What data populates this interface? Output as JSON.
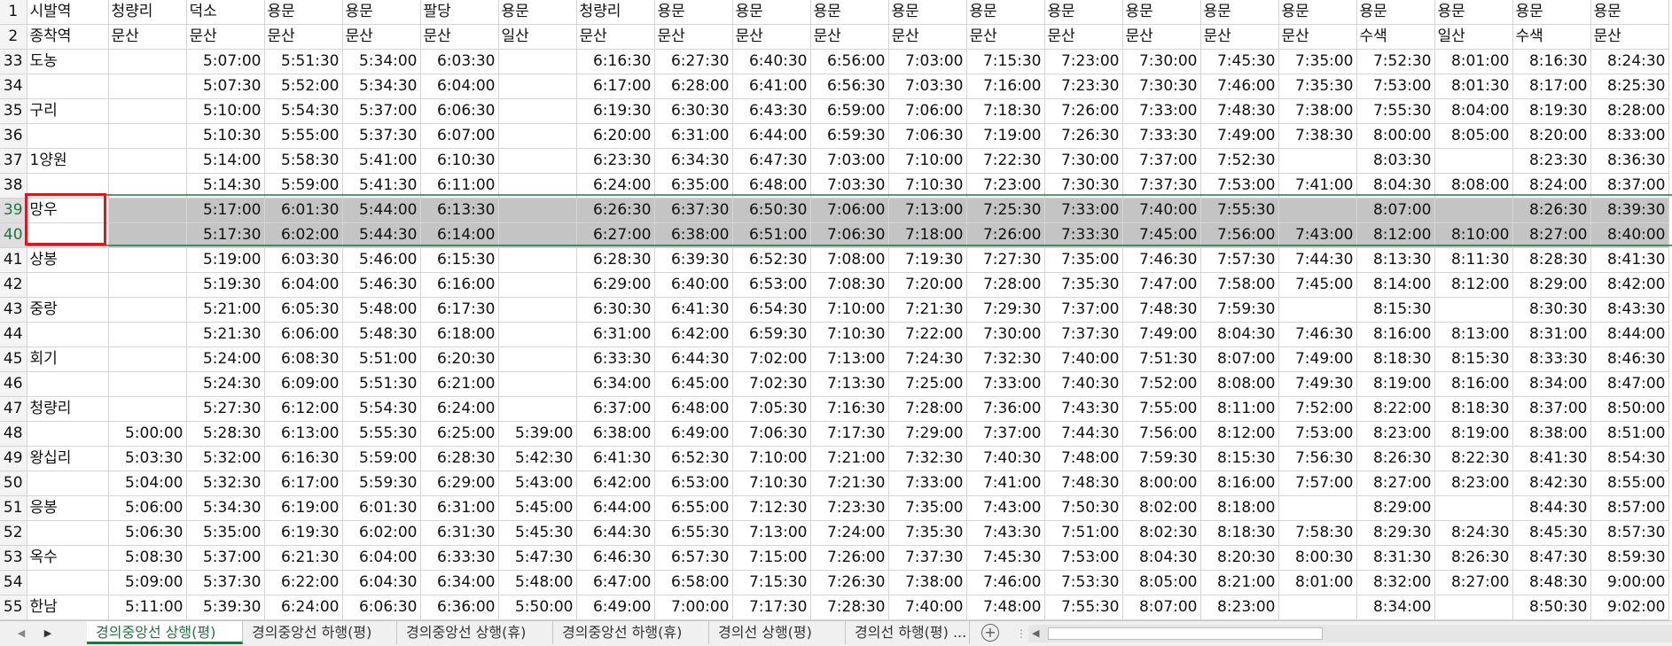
{
  "header_rows": [
    {
      "row": "1",
      "cells": [
        "시발역",
        "청량리",
        "덕소",
        "용문",
        "용문",
        "팔당",
        "용문",
        "청량리",
        "용문",
        "용문",
        "용문",
        "용문",
        "용문",
        "용문",
        "용문",
        "용문",
        "용문",
        "용문",
        "용문",
        "용문",
        "용문",
        "용문"
      ]
    },
    {
      "row": "2",
      "cells": [
        "종착역",
        "문산",
        "문산",
        "문산",
        "문산",
        "문산",
        "일산",
        "문산",
        "문산",
        "문산",
        "문산",
        "문산",
        "문산",
        "문산",
        "문산",
        "문산",
        "문산",
        "수색",
        "일산",
        "수색",
        "문산",
        "문산"
      ]
    }
  ],
  "rows": [
    {
      "row": "33",
      "cells": [
        "도농",
        "",
        "5:07:00",
        "5:51:30",
        "5:34:00",
        "6:03:30",
        "",
        "6:16:30",
        "6:27:30",
        "6:40:30",
        "6:56:00",
        "7:03:00",
        "7:15:30",
        "7:23:00",
        "7:30:00",
        "7:45:30",
        "7:35:00",
        "7:52:30",
        "8:01:00",
        "8:16:30",
        "8:24:30"
      ]
    },
    {
      "row": "34",
      "cells": [
        "",
        "",
        "5:07:30",
        "5:52:00",
        "5:34:30",
        "6:04:00",
        "",
        "6:17:00",
        "6:28:00",
        "6:41:00",
        "6:56:30",
        "7:03:30",
        "7:16:00",
        "7:23:30",
        "7:30:30",
        "7:46:00",
        "7:35:30",
        "7:53:00",
        "8:01:30",
        "8:17:00",
        "8:25:30"
      ]
    },
    {
      "row": "35",
      "cells": [
        "구리",
        "",
        "5:10:00",
        "5:54:30",
        "5:37:00",
        "6:06:30",
        "",
        "6:19:30",
        "6:30:30",
        "6:43:30",
        "6:59:00",
        "7:06:00",
        "7:18:30",
        "7:26:00",
        "7:33:00",
        "7:48:30",
        "7:38:00",
        "7:55:30",
        "8:04:00",
        "8:19:30",
        "8:28:00"
      ]
    },
    {
      "row": "36",
      "cells": [
        "",
        "",
        "5:10:30",
        "5:55:00",
        "5:37:30",
        "6:07:00",
        "",
        "6:20:00",
        "6:31:00",
        "6:44:00",
        "6:59:30",
        "7:06:30",
        "7:19:00",
        "7:26:30",
        "7:33:30",
        "7:49:00",
        "7:38:30",
        "8:00:00",
        "8:05:00",
        "8:20:00",
        "8:33:00"
      ]
    },
    {
      "row": "37",
      "cells": [
        "1양원",
        "",
        "5:14:00",
        "5:58:30",
        "5:41:00",
        "6:10:30",
        "",
        "6:23:30",
        "6:34:30",
        "6:47:30",
        "7:03:00",
        "7:10:00",
        "7:22:30",
        "7:30:00",
        "7:37:00",
        "7:52:30",
        "",
        "8:03:30",
        "",
        "8:23:30",
        "8:36:30"
      ]
    },
    {
      "row": "38",
      "cells": [
        "",
        "",
        "5:14:30",
        "5:59:00",
        "5:41:30",
        "6:11:00",
        "",
        "6:24:00",
        "6:35:00",
        "6:48:00",
        "7:03:30",
        "7:10:30",
        "7:23:00",
        "7:30:30",
        "7:37:30",
        "7:53:00",
        "7:41:00",
        "8:04:30",
        "8:08:00",
        "8:24:00",
        "8:37:00"
      ]
    },
    {
      "row": "39",
      "sel": true,
      "cells": [
        "망우",
        "",
        "5:17:00",
        "6:01:30",
        "5:44:00",
        "6:13:30",
        "",
        "6:26:30",
        "6:37:30",
        "6:50:30",
        "7:06:00",
        "7:13:00",
        "7:25:30",
        "7:33:00",
        "7:40:00",
        "7:55:30",
        "",
        "8:07:00",
        "",
        "8:26:30",
        "8:39:30"
      ]
    },
    {
      "row": "40",
      "sel": true,
      "cells": [
        "",
        "",
        "5:17:30",
        "6:02:00",
        "5:44:30",
        "6:14:00",
        "",
        "6:27:00",
        "6:38:00",
        "6:51:00",
        "7:06:30",
        "7:18:00",
        "7:26:00",
        "7:33:30",
        "7:45:00",
        "7:56:00",
        "7:43:00",
        "8:12:00",
        "8:10:00",
        "8:27:00",
        "8:40:00"
      ]
    },
    {
      "row": "41",
      "cells": [
        "상봉",
        "",
        "5:19:00",
        "6:03:30",
        "5:46:00",
        "6:15:30",
        "",
        "6:28:30",
        "6:39:30",
        "6:52:30",
        "7:08:00",
        "7:19:30",
        "7:27:30",
        "7:35:00",
        "7:46:30",
        "7:57:30",
        "7:44:30",
        "8:13:30",
        "8:11:30",
        "8:28:30",
        "8:41:30"
      ]
    },
    {
      "row": "42",
      "cells": [
        "",
        "",
        "5:19:30",
        "6:04:00",
        "5:46:30",
        "6:16:00",
        "",
        "6:29:00",
        "6:40:00",
        "6:53:00",
        "7:08:30",
        "7:20:00",
        "7:28:00",
        "7:35:30",
        "7:47:00",
        "7:58:00",
        "7:45:00",
        "8:14:00",
        "8:12:00",
        "8:29:00",
        "8:42:00"
      ]
    },
    {
      "row": "43",
      "cells": [
        "중랑",
        "",
        "5:21:00",
        "6:05:30",
        "5:48:00",
        "6:17:30",
        "",
        "6:30:30",
        "6:41:30",
        "6:54:30",
        "7:10:00",
        "7:21:30",
        "7:29:30",
        "7:37:00",
        "7:48:30",
        "7:59:30",
        "",
        "8:15:30",
        "",
        "8:30:30",
        "8:43:30"
      ]
    },
    {
      "row": "44",
      "cells": [
        "",
        "",
        "5:21:30",
        "6:06:00",
        "5:48:30",
        "6:18:00",
        "",
        "6:31:00",
        "6:42:00",
        "6:59:30",
        "7:10:30",
        "7:22:00",
        "7:30:00",
        "7:37:30",
        "7:49:00",
        "8:04:30",
        "7:46:30",
        "8:16:00",
        "8:13:00",
        "8:31:00",
        "8:44:00"
      ]
    },
    {
      "row": "45",
      "cells": [
        "회기",
        "",
        "5:24:00",
        "6:08:30",
        "5:51:00",
        "6:20:30",
        "",
        "6:33:30",
        "6:44:30",
        "7:02:00",
        "7:13:00",
        "7:24:30",
        "7:32:30",
        "7:40:00",
        "7:51:30",
        "8:07:00",
        "7:49:00",
        "8:18:30",
        "8:15:30",
        "8:33:30",
        "8:46:30"
      ]
    },
    {
      "row": "46",
      "cells": [
        "",
        "",
        "5:24:30",
        "6:09:00",
        "5:51:30",
        "6:21:00",
        "",
        "6:34:00",
        "6:45:00",
        "7:02:30",
        "7:13:30",
        "7:25:00",
        "7:33:00",
        "7:40:30",
        "7:52:00",
        "8:08:00",
        "7:49:30",
        "8:19:00",
        "8:16:00",
        "8:34:00",
        "8:47:00"
      ]
    },
    {
      "row": "47",
      "cells": [
        "청량리",
        "",
        "5:27:30",
        "6:12:00",
        "5:54:30",
        "6:24:00",
        "",
        "6:37:00",
        "6:48:00",
        "7:05:30",
        "7:16:30",
        "7:28:00",
        "7:36:00",
        "7:43:30",
        "7:55:00",
        "8:11:00",
        "7:52:00",
        "8:22:00",
        "8:18:30",
        "8:37:00",
        "8:50:00"
      ]
    },
    {
      "row": "48",
      "cells": [
        "",
        "5:00:00",
        "5:28:30",
        "6:13:00",
        "5:55:30",
        "6:25:00",
        "5:39:00",
        "6:38:00",
        "6:49:00",
        "7:06:30",
        "7:17:30",
        "7:29:00",
        "7:37:00",
        "7:44:30",
        "7:56:00",
        "8:12:00",
        "7:53:00",
        "8:23:00",
        "8:19:00",
        "8:38:00",
        "8:51:00"
      ]
    },
    {
      "row": "49",
      "cells": [
        "왕십리",
        "5:03:30",
        "5:32:00",
        "6:16:30",
        "5:59:00",
        "6:28:30",
        "5:42:30",
        "6:41:30",
        "6:52:30",
        "7:10:00",
        "7:21:00",
        "7:32:30",
        "7:40:30",
        "7:48:00",
        "7:59:30",
        "8:15:30",
        "7:56:30",
        "8:26:30",
        "8:22:30",
        "8:41:30",
        "8:54:30"
      ]
    },
    {
      "row": "50",
      "cells": [
        "",
        "5:04:00",
        "5:32:30",
        "6:17:00",
        "5:59:30",
        "6:29:00",
        "5:43:00",
        "6:42:00",
        "6:53:00",
        "7:10:30",
        "7:21:30",
        "7:33:00",
        "7:41:00",
        "7:48:30",
        "8:00:00",
        "8:16:00",
        "7:57:00",
        "8:27:00",
        "8:23:00",
        "8:42:30",
        "8:55:00"
      ]
    },
    {
      "row": "51",
      "cells": [
        "응봉",
        "5:06:00",
        "5:34:30",
        "6:19:00",
        "6:01:30",
        "6:31:00",
        "5:45:00",
        "6:44:00",
        "6:55:00",
        "7:12:30",
        "7:23:30",
        "7:35:00",
        "7:43:00",
        "7:50:30",
        "8:02:00",
        "8:18:00",
        "",
        "8:29:00",
        "",
        "8:44:30",
        "8:57:00"
      ]
    },
    {
      "row": "52",
      "cells": [
        "",
        "5:06:30",
        "5:35:00",
        "6:19:30",
        "6:02:00",
        "6:31:30",
        "5:45:30",
        "6:44:30",
        "6:55:30",
        "7:13:00",
        "7:24:00",
        "7:35:30",
        "7:43:30",
        "7:51:00",
        "8:02:30",
        "8:18:30",
        "7:58:30",
        "8:29:30",
        "8:24:30",
        "8:45:30",
        "8:57:30"
      ]
    },
    {
      "row": "53",
      "cells": [
        "옥수",
        "5:08:30",
        "5:37:00",
        "6:21:30",
        "6:04:00",
        "6:33:30",
        "5:47:30",
        "6:46:30",
        "6:57:30",
        "7:15:00",
        "7:26:00",
        "7:37:30",
        "7:45:30",
        "7:53:00",
        "8:04:30",
        "8:20:30",
        "8:00:30",
        "8:31:30",
        "8:26:30",
        "8:47:30",
        "8:59:30"
      ]
    },
    {
      "row": "54",
      "cells": [
        "",
        "5:09:00",
        "5:37:30",
        "6:22:00",
        "6:04:30",
        "6:34:00",
        "5:48:00",
        "6:47:00",
        "6:58:00",
        "7:15:30",
        "7:26:30",
        "7:38:00",
        "7:46:00",
        "7:53:30",
        "8:05:00",
        "8:21:00",
        "8:01:00",
        "8:32:00",
        "8:27:00",
        "8:48:30",
        "9:00:00"
      ]
    },
    {
      "row": "55",
      "cells": [
        "한남",
        "5:11:00",
        "5:39:30",
        "6:24:00",
        "6:06:30",
        "6:36:00",
        "5:50:00",
        "6:49:00",
        "7:00:00",
        "7:17:30",
        "7:28:30",
        "7:40:00",
        "7:48:00",
        "7:55:30",
        "8:07:00",
        "8:23:00",
        "",
        "8:34:00",
        "",
        "8:50:30",
        "9:02:00"
      ]
    }
  ],
  "tabs": [
    "경의중앙선 상행(평)",
    "경의중앙선 하행(평)",
    "경의중앙선 상행(휴)",
    "경의중앙선 하행(휴)",
    "경의선 상행(평)",
    "경의선 하행(평) ..."
  ],
  "nav": {
    "prev_icon": "triangle-left-icon",
    "next_icon": "triangle-right-icon",
    "add": "+",
    "separator": "⋮"
  },
  "colors": {
    "selection_border": "#e3141c",
    "selected_fill": "#c4c4c4",
    "active_tab": "#217346"
  }
}
